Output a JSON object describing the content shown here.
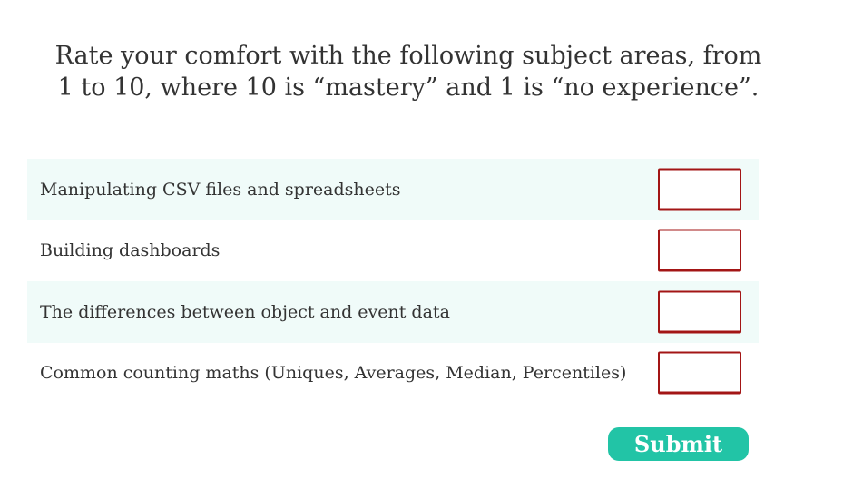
{
  "question": {
    "line1": "Rate your comfort with the following subject areas, from",
    "line2": "1 to 10, where 10 is “mastery” and 1 is “no experience”."
  },
  "rows": [
    {
      "label": "Manipulating CSV files and spreadsheets",
      "value": ""
    },
    {
      "label": "Building dashboards",
      "value": ""
    },
    {
      "label": "The differences between object and event data",
      "value": ""
    },
    {
      "label": "Common counting maths (Uniques, Averages, Median, Percentiles)",
      "value": ""
    }
  ],
  "submit": {
    "label": "Submit"
  },
  "colors": {
    "accent": "#22c4a6",
    "input_border": "#a31515",
    "row_shade": "#f0fbf9",
    "text": "#333333"
  }
}
